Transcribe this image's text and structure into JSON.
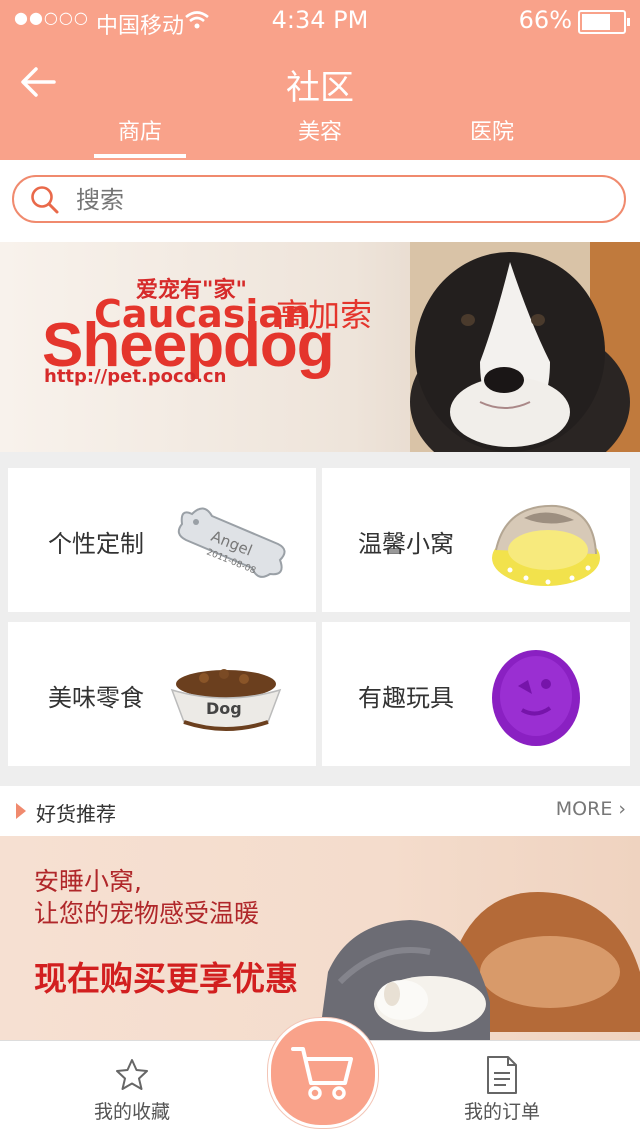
{
  "status_bar": {
    "signal": "●●○○○",
    "carrier": "中国移动",
    "time": "4:34 PM",
    "battery": "66%"
  },
  "header": {
    "title": "社区"
  },
  "tabs": [
    {
      "label": "商店"
    },
    {
      "label": "美容"
    },
    {
      "label": "医院"
    }
  ],
  "search": {
    "placeholder": "搜索"
  },
  "banner": {
    "tagline": "爱宠有\"家\"",
    "breed_en_1": "Caucasian",
    "breed_cn": "高加索",
    "breed_en_2": "Sheepdog",
    "url": "http://pet.poco.cn"
  },
  "categories": [
    {
      "label": "个性定制",
      "icon": "bone-tag-icon",
      "tag_text": "Angel",
      "tag_date": "2011-08-08"
    },
    {
      "label": "温馨小窝",
      "icon": "pet-bed-icon"
    },
    {
      "label": "美味零食",
      "icon": "dog-bowl-icon",
      "bowl_text": "Dog"
    },
    {
      "label": "有趣玩具",
      "icon": "frisbee-icon"
    }
  ],
  "recommend": {
    "title": "好货推荐",
    "more": "MORE"
  },
  "promo": {
    "line1": "安睡小窝,",
    "line2": "让您的宠物感受温暖",
    "line3": "现在购买更享优惠"
  },
  "bottom_nav": {
    "favorites": "我的收藏",
    "orders": "我的订单",
    "cart_icon": "cart-icon"
  },
  "colors": {
    "accent": "#f9a28a",
    "border": "#f08a6e",
    "promo_red": "#d21f1f"
  }
}
